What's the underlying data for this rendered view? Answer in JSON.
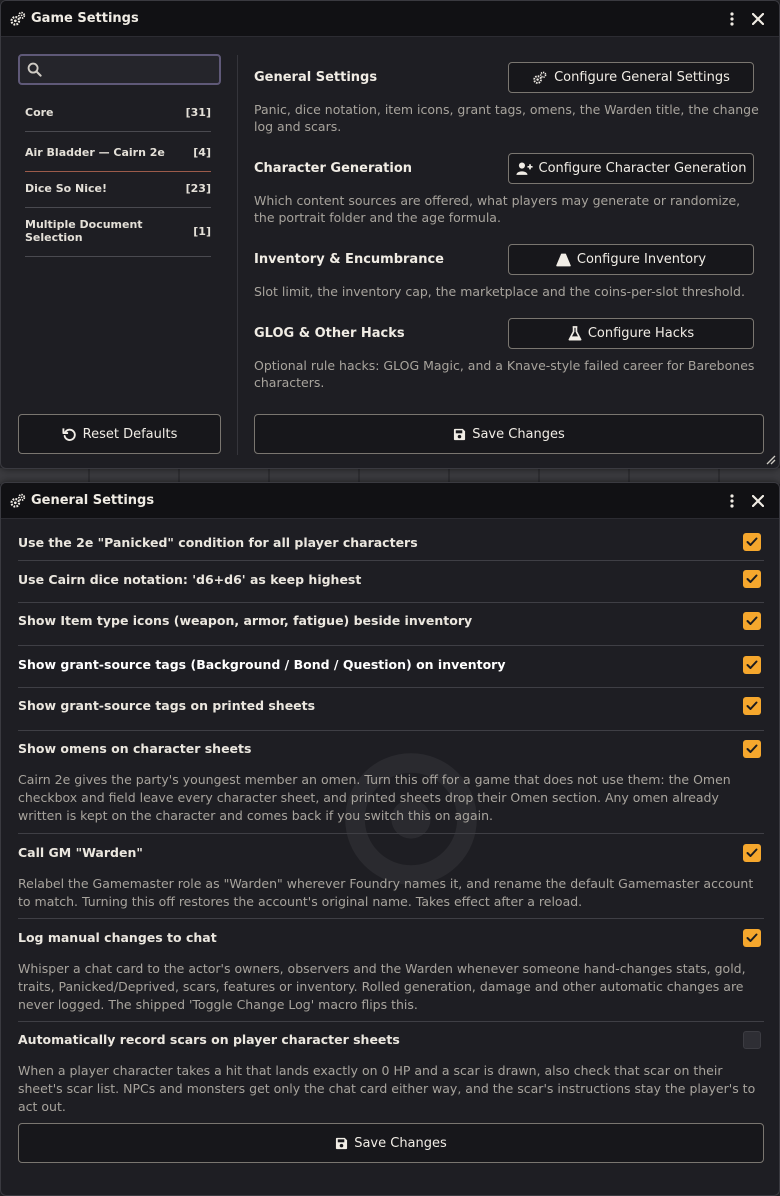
{
  "colors": {
    "accent": "#f5a72d",
    "input_border": "#5f5978",
    "active_divider": "#9c5b4a"
  },
  "game_settings": {
    "title": "Game Settings",
    "search": {
      "placeholder": "",
      "value": ""
    },
    "categories": [
      {
        "label": "Core",
        "count": "[31]",
        "active": false
      },
      {
        "label": "Air Bladder — Cairn 2e",
        "count": "[4]",
        "active": true
      },
      {
        "label": "Dice So Nice!",
        "count": "[23]",
        "active": false
      },
      {
        "label": "Multiple Document Selection",
        "count": "[1]",
        "active": false
      }
    ],
    "sections": [
      {
        "title": "General Settings",
        "button": "Configure General Settings",
        "icon": "gears-icon",
        "desc": "Panic, dice notation, item icons, grant tags, omens, the Warden title, the change log and scars."
      },
      {
        "title": "Character Generation",
        "button": "Configure Character Generation",
        "icon": "user-plus-icon",
        "desc": "Which content sources are offered, what players may generate or randomize, the portrait folder and the age formula."
      },
      {
        "title": "Inventory & Encumbrance",
        "button": "Configure Inventory",
        "icon": "bell-icon",
        "desc": "Slot limit, the inventory cap, the marketplace and the coins-per-slot threshold."
      },
      {
        "title": "GLOG & Other Hacks",
        "button": "Configure Hacks",
        "icon": "flask-icon",
        "desc": "Optional rule hacks: GLOG Magic, and a Knave-style failed career for Barebones characters."
      }
    ],
    "reset_label": "Reset Defaults",
    "save_label": "Save Changes"
  },
  "general_settings": {
    "title": "General Settings",
    "rows": [
      {
        "label": "Use the 2e \"Panicked\" condition for all player characters",
        "checked": true,
        "desc": ""
      },
      {
        "label": "Use Cairn dice notation: 'd6+d6' as keep highest",
        "checked": true,
        "desc": ""
      },
      {
        "label": "Show Item type icons (weapon, armor, fatigue) beside inventory",
        "checked": true,
        "desc": ""
      },
      {
        "label": "Show grant-source tags (Background / Bond / Question) on inventory",
        "checked": true,
        "desc": ""
      },
      {
        "label": "Show grant-source tags on printed sheets",
        "checked": true,
        "desc": ""
      },
      {
        "label": "Show omens on character sheets",
        "checked": true,
        "desc": "Cairn 2e gives the party's youngest member an omen. Turn this off for a game that does not use them: the Omen checkbox and field leave every character sheet, and printed sheets drop their Omen section. Any omen already written is kept on the character and comes back if you switch this on again."
      },
      {
        "label": "Call GM \"Warden\"",
        "checked": true,
        "desc": "Relabel the Gamemaster role as \"Warden\" wherever Foundry names it, and rename the default Gamemaster account to match. Turning this off restores the account's original name. Takes effect after a reload."
      },
      {
        "label": "Log manual changes to chat",
        "checked": true,
        "desc": "Whisper a chat card to the actor's owners, observers and the Warden whenever someone hand-changes stats, gold, traits, Panicked/Deprived, scars, features or inventory. Rolled generation, damage and other automatic changes are never logged. The shipped 'Toggle Change Log' macro flips this."
      },
      {
        "label": "Automatically record scars on player character sheets",
        "checked": false,
        "desc": "When a player character takes a hit that lands exactly on 0 HP and a scar is drawn, also check that scar on their sheet's scar list. NPCs and monsters get only the chat card either way, and the scar's instructions stay the player's to act out."
      }
    ],
    "save_label": "Save Changes"
  }
}
